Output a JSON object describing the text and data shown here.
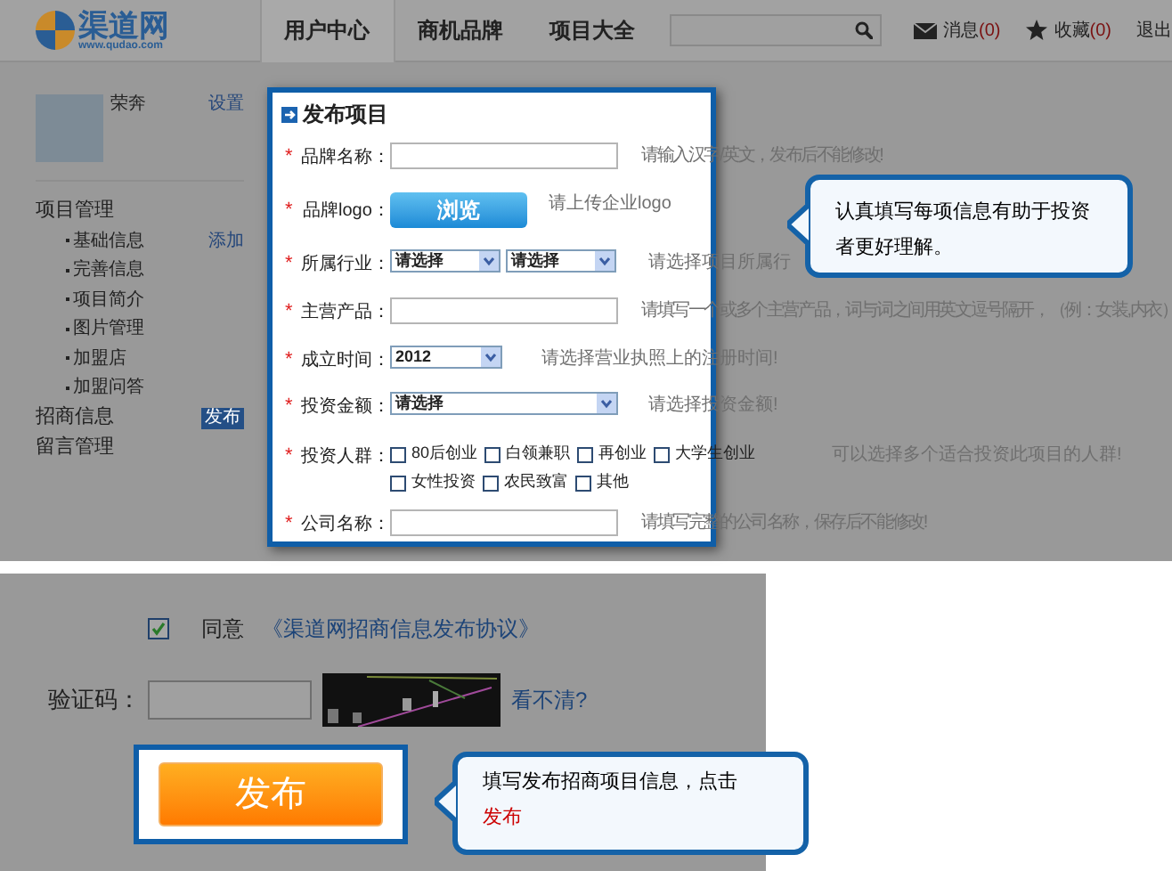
{
  "header": {
    "logo": {
      "name": "渠道网",
      "url": "www.qudao.com"
    },
    "nav": [
      {
        "label": "用户中心",
        "selected": true
      },
      {
        "label": "商机品牌",
        "selected": false
      },
      {
        "label": "项目大全",
        "selected": false
      }
    ],
    "links": [
      {
        "kind": "mail",
        "label": "消息",
        "count": "(0)"
      },
      {
        "kind": "star",
        "label": "收藏",
        "count": "(0)"
      },
      {
        "kind": "plain",
        "label": "退出"
      }
    ]
  },
  "sidebar": {
    "user": "荣奔",
    "settings": "设置",
    "menu": [
      {
        "label": "项目管理",
        "children": [
          {
            "label": "基础信息",
            "action": "添加"
          },
          {
            "label": "完善信息"
          },
          {
            "label": "项目简介"
          },
          {
            "label": "图片管理"
          },
          {
            "label": "加盟店"
          },
          {
            "label": "加盟问答"
          }
        ]
      },
      {
        "label": "招商信息",
        "badge": "发布"
      },
      {
        "label": "留言管理"
      }
    ]
  },
  "form": {
    "title": "发布项目",
    "rows": [
      {
        "kind": "text",
        "mark": "*",
        "label": "品牌名称：",
        "hint": "请输入汉字/英文，发布后不能修改!"
      },
      {
        "kind": "upload",
        "mark": "*",
        "label": "品牌logo：",
        "button": "浏览",
        "hint": "请上传企业logo"
      },
      {
        "kind": "selects",
        "mark": "*",
        "label": "所属行业：",
        "selects": [
          "请选择",
          "请选择"
        ],
        "hint": "请选择项目所属行"
      },
      {
        "kind": "text",
        "mark": "*",
        "label": "主营产品：",
        "hint": "请填写一个或多个主营产品，词与词之间用英文逗号隔开，（例：女装,内衣）"
      },
      {
        "kind": "select-short",
        "mark": "*",
        "label": "成立时间：",
        "select": "2012",
        "hint": "请选择营业执照上的注册时间!"
      },
      {
        "kind": "select-wide",
        "mark": "*",
        "label": "投资金额：",
        "select": "请选择",
        "hint": "请选择投资金额!"
      },
      {
        "kind": "checkboxes",
        "mark": "*",
        "label": "投资人群：",
        "options": [
          {
            "label": "80后创业",
            "checked": false
          },
          {
            "label": "白领兼职",
            "checked": false
          },
          {
            "label": "再创业",
            "checked": false
          },
          {
            "label": "大学生创业",
            "checked": false
          },
          {
            "label": "女性投资",
            "checked": false
          },
          {
            "label": "农民致富",
            "checked": false
          },
          {
            "label": "其他",
            "checked": false
          }
        ],
        "hint": "可以选择多个适合投资此项目的人群!"
      },
      {
        "kind": "text",
        "mark": "*",
        "label": "公司名称：",
        "hint": "请填写完整的公司名称，保存后不能修改!"
      }
    ]
  },
  "callout_top": {
    "text": "认真填写每项信息有助于投资者更好理解。"
  },
  "agreement": {
    "checked": true,
    "label": "同意",
    "link": "《渠道网招商信息发布协议》"
  },
  "captcha": {
    "label": "验证码：",
    "refresh": "看不清?"
  },
  "submit": {
    "label": "发布"
  },
  "callout_bottom": {
    "text": "填写发布招商项目信息，点击",
    "emphasis": "发布"
  }
}
